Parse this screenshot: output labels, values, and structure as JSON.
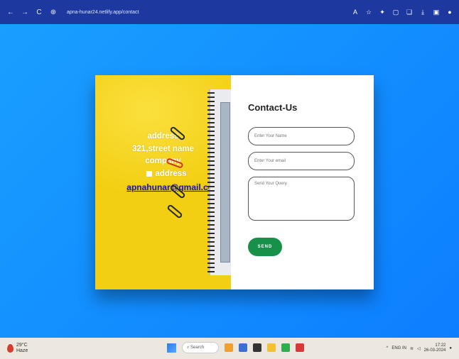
{
  "browser": {
    "back": "←",
    "forward": "→",
    "reload": "C",
    "url": "apna-hunar24.netlify.app/contact"
  },
  "card": {
    "info": {
      "address_label": "address",
      "street": "321,street name",
      "company": "company",
      "address2": "address",
      "email": "apnahunar@gmail.com"
    },
    "form": {
      "title": "Contact-Us",
      "name_placeholder": "Enter Your Name",
      "email_placeholder": "Enter Your email",
      "message_placeholder": "Send Your Query",
      "send_label": "SEND"
    }
  },
  "taskbar": {
    "temperature": "29°C",
    "weather_text": "Haze",
    "search_label": "Search",
    "time": "17:22",
    "date": "26-03-2024",
    "lang": "ENG IN"
  }
}
